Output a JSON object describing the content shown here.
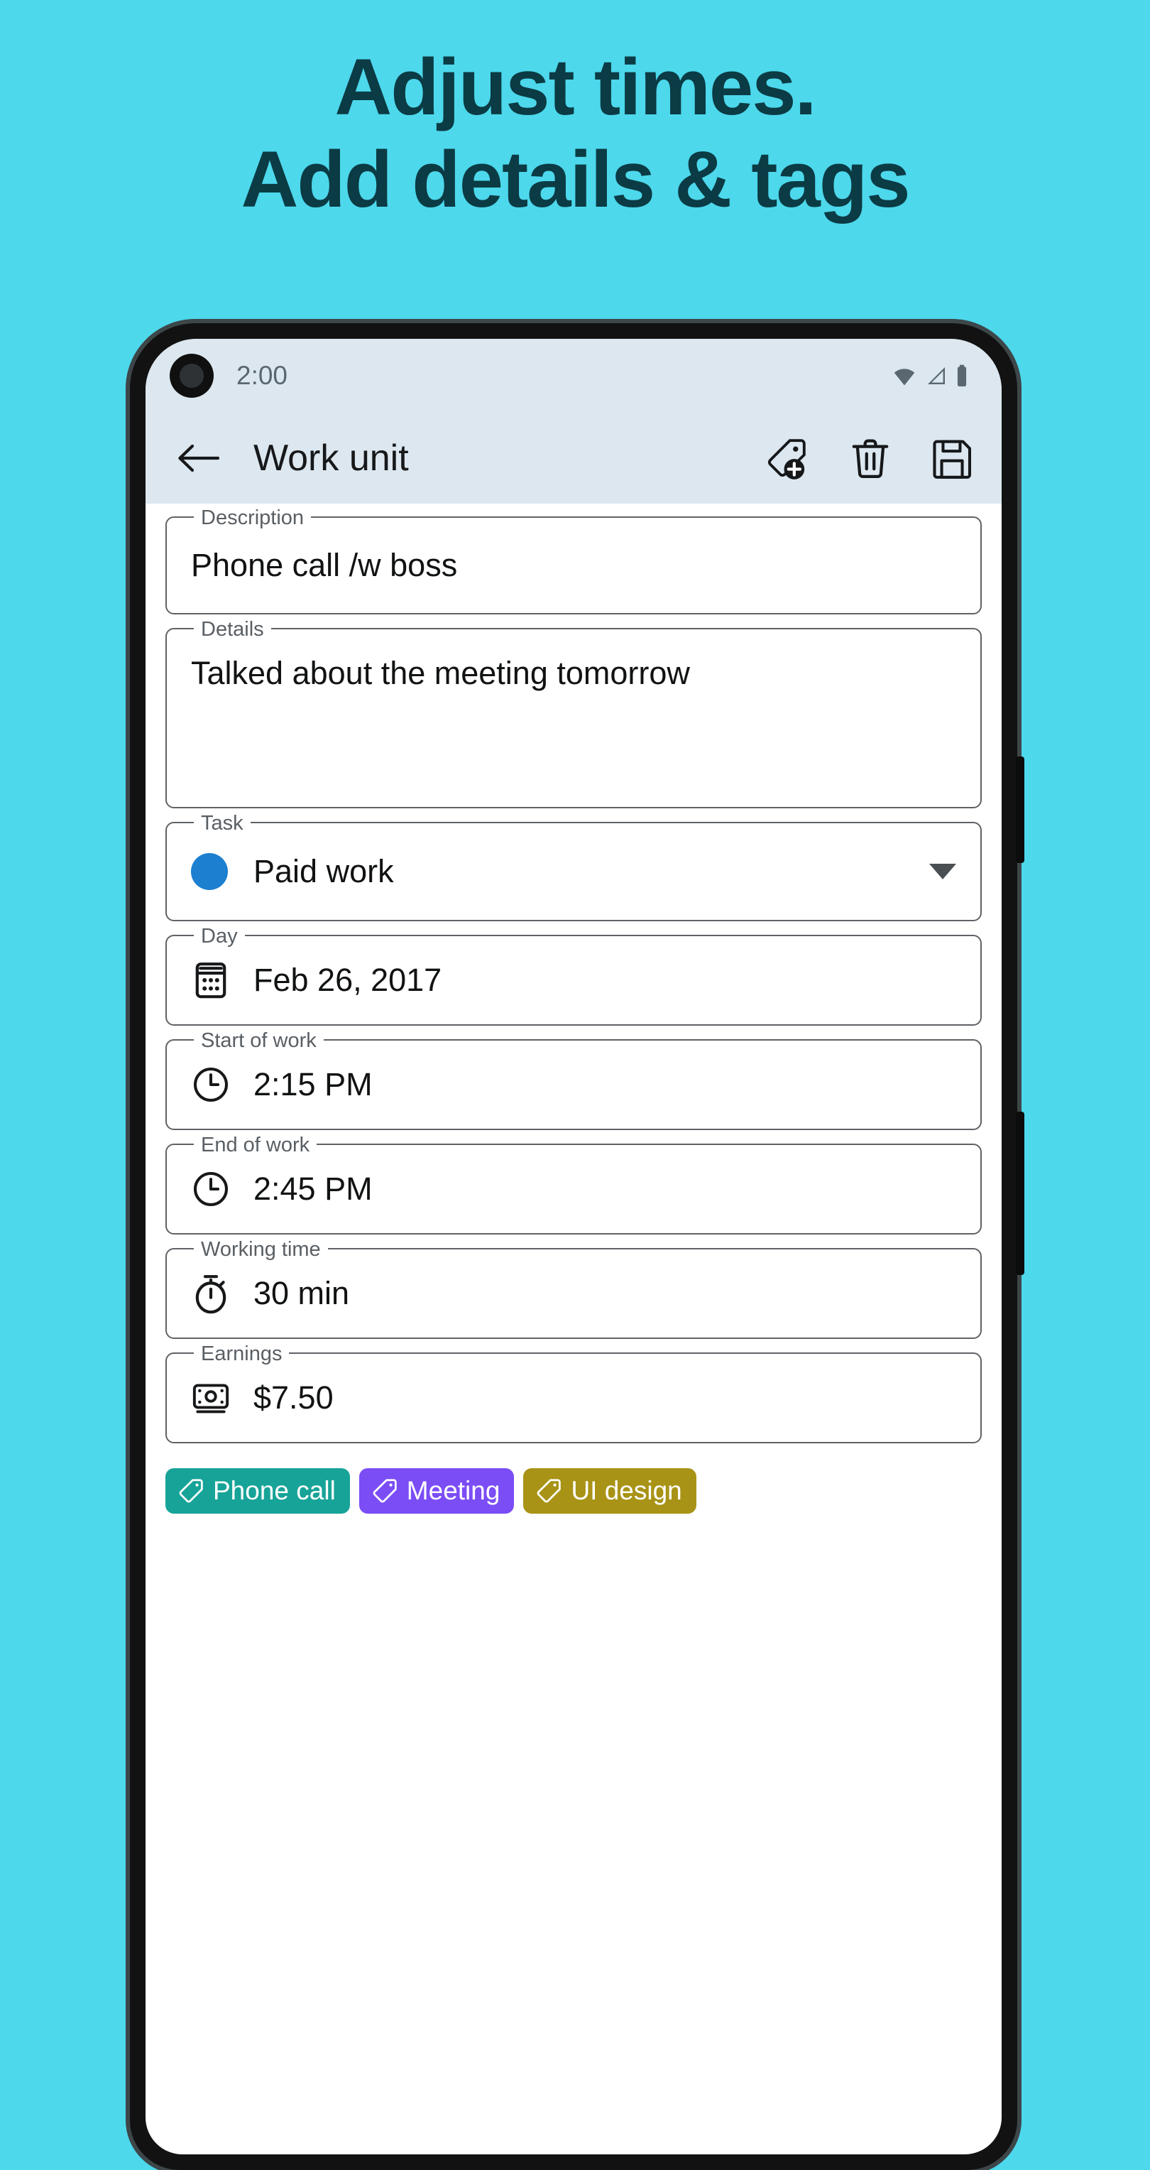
{
  "promo": {
    "headline_line1": "Adjust times.",
    "headline_line2": "Add details & tags",
    "background_color": "#4dd8ec",
    "headline_color": "#0b3b44"
  },
  "statusbar": {
    "time": "2:00",
    "icons": [
      "wifi-icon",
      "cellular-signal-icon",
      "battery-icon"
    ]
  },
  "appbar": {
    "title": "Work unit",
    "back_icon": "back-arrow-icon",
    "actions": [
      {
        "icon": "add-tag-icon",
        "label": "Add tag"
      },
      {
        "icon": "delete-icon",
        "label": "Delete"
      },
      {
        "icon": "save-icon",
        "label": "Save"
      }
    ]
  },
  "form": {
    "description": {
      "label": "Description",
      "value": "Phone call /w boss"
    },
    "details": {
      "label": "Details",
      "value": "Talked about the meeting tomorrow"
    },
    "task": {
      "label": "Task",
      "value": "Paid work",
      "color": "#1d7fd0",
      "icon": "task-color-dot",
      "chevron": "chevron-down-icon"
    },
    "day": {
      "label": "Day",
      "value": "Feb 26, 2017",
      "icon": "calendar-icon"
    },
    "start_of_work": {
      "label": "Start of work",
      "value": "2:15 PM",
      "icon": "clock-icon"
    },
    "end_of_work": {
      "label": "End of work",
      "value": "2:45 PM",
      "icon": "clock-icon"
    },
    "working_time": {
      "label": "Working time",
      "value": "30 min",
      "icon": "stopwatch-icon"
    },
    "earnings": {
      "label": "Earnings",
      "value": "$7.50",
      "icon": "money-icon"
    }
  },
  "tags": [
    {
      "label": "Phone call",
      "color": "#17a398",
      "icon": "tag-icon"
    },
    {
      "label": "Meeting",
      "color": "#7b4df5",
      "icon": "tag-icon"
    },
    {
      "label": "UI design",
      "color": "#a89316",
      "icon": "tag-icon"
    }
  ]
}
